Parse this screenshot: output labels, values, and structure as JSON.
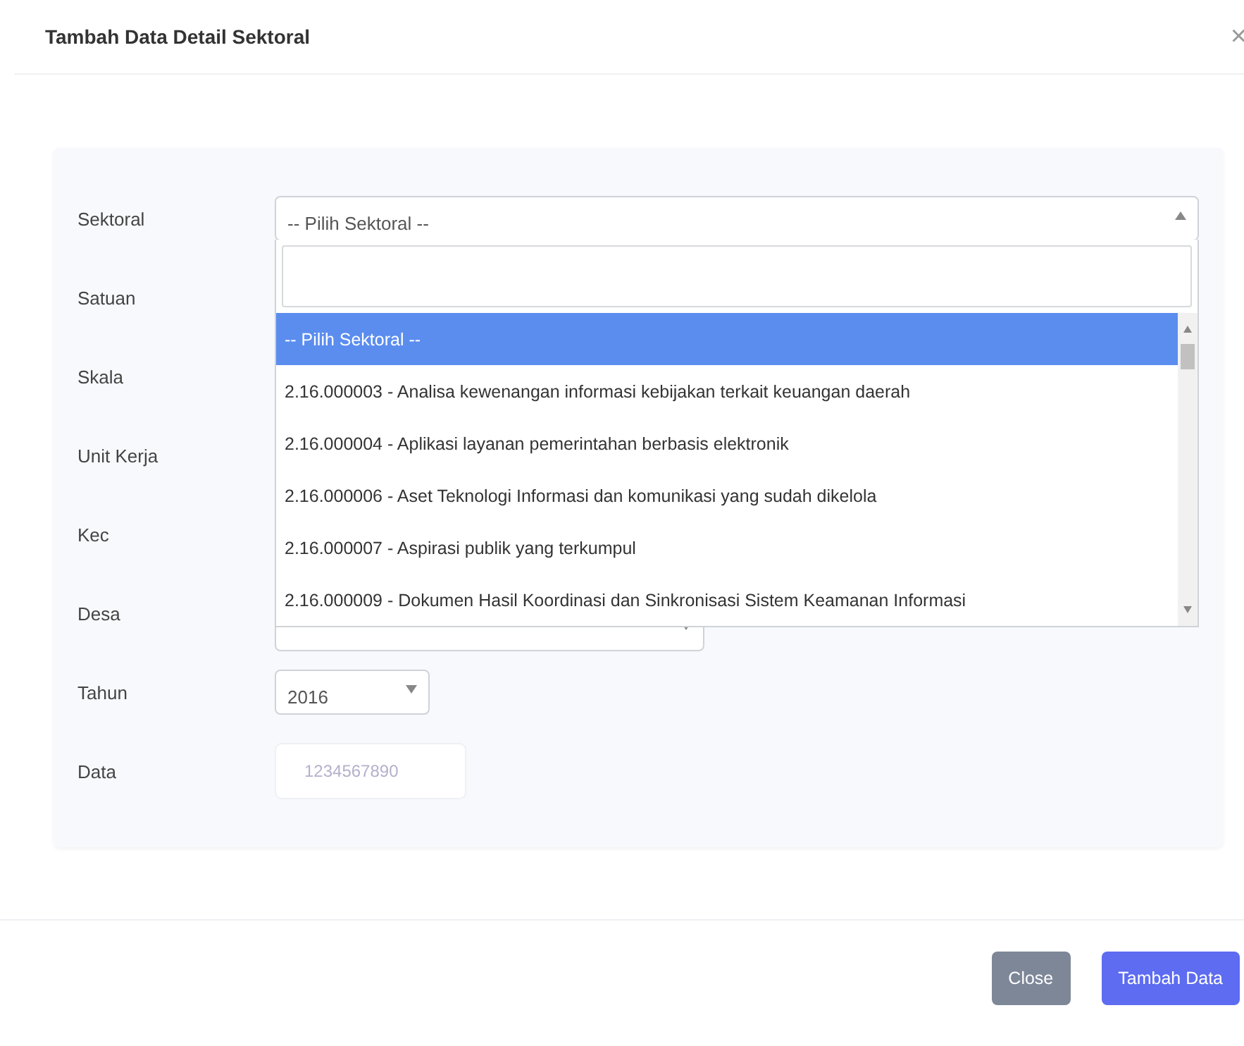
{
  "dialog": {
    "title": "Tambah Data Detail Sektoral",
    "close": "×"
  },
  "form": {
    "rows": [
      {
        "label": "Sektoral",
        "kind": "select-open",
        "value": "-- Pilih Sektoral --"
      },
      {
        "label": "Satuan",
        "kind": "covered"
      },
      {
        "label": "Skala",
        "kind": "covered"
      },
      {
        "label": "Unit Kerja",
        "kind": "covered"
      },
      {
        "label": "Kec",
        "kind": "covered"
      },
      {
        "label": "Desa",
        "kind": "select"
      },
      {
        "label": "Tahun",
        "kind": "select-small",
        "value": "2016"
      },
      {
        "label": "Data",
        "kind": "input",
        "placeholder": "1234567890"
      }
    ]
  },
  "dropdown": {
    "options": [
      {
        "label": "-- Pilih Sektoral --",
        "selected": true
      },
      {
        "label": "2.16.000003 - Analisa kewenangan informasi kebijakan terkait keuangan daerah",
        "selected": false
      },
      {
        "label": "2.16.000004 - Aplikasi layanan pemerintahan berbasis elektronik",
        "selected": false
      },
      {
        "label": "2.16.000006 - Aset Teknologi Informasi dan komunikasi yang sudah dikelola",
        "selected": false
      },
      {
        "label": "2.16.000007 - Aspirasi publik yang terkumpul",
        "selected": false
      },
      {
        "label": "2.16.000009 - Dokumen Hasil Koordinasi dan Sinkronisasi Sistem Keamanan Informasi",
        "selected": false
      }
    ]
  },
  "footer": {
    "buttons": [
      {
        "label": "Close",
        "kind": "secondary"
      },
      {
        "label": "Tambah Data",
        "kind": "primary"
      }
    ]
  }
}
